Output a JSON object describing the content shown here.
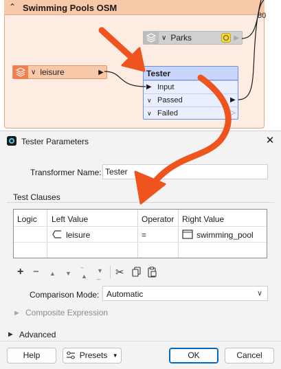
{
  "canvas": {
    "bookmark_title": "Swimming Pools OSM",
    "edge_label": "80",
    "parks_reader": {
      "label": "Parks"
    },
    "leisure_reader": {
      "label": "leisure"
    },
    "tester": {
      "title": "Tester",
      "ports": [
        {
          "label": "Input"
        },
        {
          "label": "Passed"
        },
        {
          "label": "Failed"
        }
      ]
    }
  },
  "dialog": {
    "title": "Tester Parameters",
    "transformer_name_label": "Transformer Name:",
    "transformer_name_value": "Tester",
    "test_clauses_title": "Test Clauses",
    "table": {
      "headers": [
        "Logic",
        "Left Value",
        "Operator",
        "Right Value"
      ],
      "rows": [
        {
          "logic": "",
          "left": "leisure",
          "operator": "=",
          "right": "swimming_pool"
        }
      ]
    },
    "comparison_mode_label": "Comparison Mode:",
    "comparison_mode_value": "Automatic",
    "composite_label": "Composite Expression",
    "advanced_label": "Advanced",
    "buttons": {
      "help": "Help",
      "presets": "Presets",
      "ok": "OK",
      "cancel": "Cancel"
    }
  },
  "colors": {
    "annotation_arrow": "#f0541e",
    "accent": "#0067c0",
    "bookmark_header": "#f6c9a9",
    "tester_header": "#c8d6fb"
  }
}
